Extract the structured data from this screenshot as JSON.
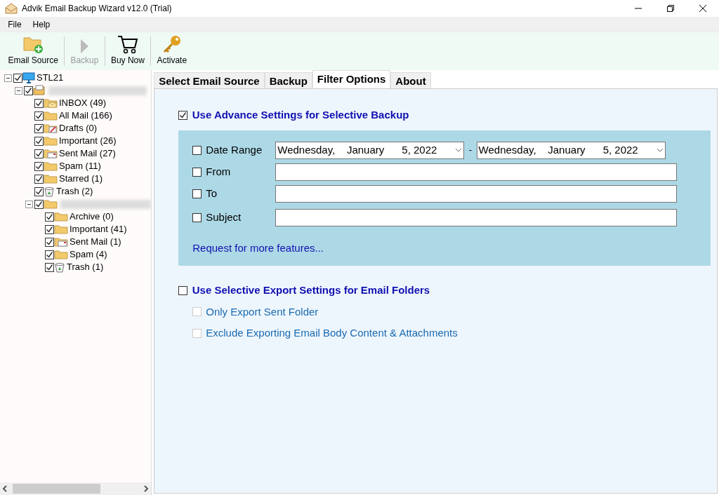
{
  "window": {
    "title": "Advik Email Backup Wizard v12.0 (Trial)"
  },
  "menu": [
    "File",
    "Help"
  ],
  "toolbar": [
    {
      "label": "Email Source",
      "kind": "source",
      "disabled": false
    },
    {
      "label": "Backup",
      "kind": "backup",
      "disabled": true
    },
    {
      "label": "Buy Now",
      "kind": "cart",
      "disabled": false
    },
    {
      "label": "Activate",
      "kind": "key",
      "disabled": false
    }
  ],
  "tree": [
    {
      "label": "STL21",
      "kind": "computer",
      "checked": true,
      "expanded": true,
      "children": [
        {
          "kind": "accounts",
          "checked": true,
          "expanded": true,
          "children": [
            {
              "label": "INBOX (49)",
              "kind": "inbox",
              "checked": true
            },
            {
              "label": "All Mail (166)",
              "kind": "folder",
              "checked": true
            },
            {
              "label": "Drafts (0)",
              "kind": "drafts",
              "checked": true
            },
            {
              "label": "Important (26)",
              "kind": "folder",
              "checked": true
            },
            {
              "label": "Sent Mail (27)",
              "kind": "sent",
              "checked": true
            },
            {
              "label": "Spam (11)",
              "kind": "folder",
              "checked": true
            },
            {
              "label": "Starred (1)",
              "kind": "folder",
              "checked": true
            },
            {
              "label": "Trash (2)",
              "kind": "trash",
              "checked": true
            },
            {
              "kind": "folder",
              "checked": true,
              "expanded": true,
              "children": [
                {
                  "label": "Archive (0)",
                  "kind": "folder",
                  "checked": true
                },
                {
                  "label": "Important (41)",
                  "kind": "folder",
                  "checked": true
                },
                {
                  "label": "Sent Mail (1)",
                  "kind": "sent",
                  "checked": true
                },
                {
                  "label": "Spam (4)",
                  "kind": "folder",
                  "checked": true
                },
                {
                  "label": "Trash (1)",
                  "kind": "trash",
                  "checked": true
                }
              ]
            }
          ]
        }
      ]
    }
  ],
  "tabs": [
    {
      "label": "Select Email Source",
      "selected": false
    },
    {
      "label": "Backup",
      "selected": false
    },
    {
      "label": "Filter Options",
      "selected": true
    },
    {
      "label": "About",
      "selected": false
    }
  ],
  "advance": {
    "label": "Use Advance Settings for Selective Backup",
    "checked": true
  },
  "date_range": {
    "label": "Date Range",
    "checked": false,
    "start": "Wednesday,    January      5, 2022",
    "separator": "-",
    "end": "Wednesday,    January      5, 2022"
  },
  "filters": [
    {
      "label": "From",
      "checked": false
    },
    {
      "label": "To",
      "checked": false
    },
    {
      "label": "Subject",
      "checked": false
    }
  ],
  "request_link": "Request for more features...",
  "export": {
    "label": "Use Selective Export Settings for Email Folders",
    "checked": false,
    "options": [
      {
        "label": "Only Export Sent Folder",
        "checked": false,
        "disabled": true
      },
      {
        "label": "Exclude Exporting Email Body Content & Attachments",
        "checked": false,
        "disabled": true
      }
    ]
  }
}
